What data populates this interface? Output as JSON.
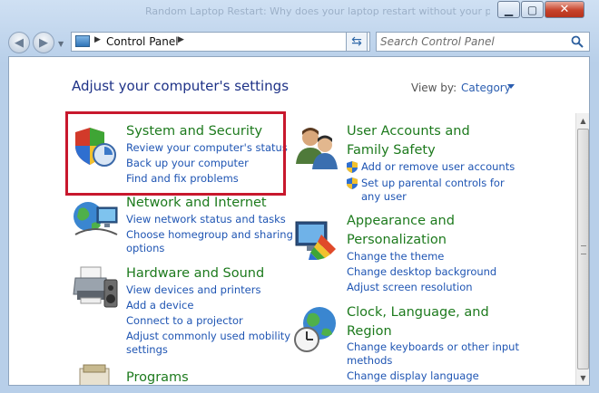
{
  "window": {
    "title_fragment": "Random Laptop Restart: Why does your laptop restart without your permission"
  },
  "nav": {
    "breadcrumb": "Control Panel",
    "search_placeholder": "Search Control Panel"
  },
  "main": {
    "heading": "Adjust your computer's settings",
    "view_by_label": "View by:",
    "view_by_value": "Category"
  },
  "categories": [
    {
      "title": "System and Security",
      "links": [
        "Review your computer's status",
        "Back up your computer",
        "Find and fix problems"
      ]
    },
    {
      "title": "Network and Internet",
      "links": [
        "View network status and tasks",
        "Choose homegroup and sharing",
        "options"
      ]
    },
    {
      "title": "Hardware and Sound",
      "links": [
        "View devices and printers",
        "Add a device",
        "Connect to a projector",
        "Adjust commonly used mobility",
        "settings"
      ]
    },
    {
      "title": "Programs",
      "links": []
    },
    {
      "title_lines": [
        "User Accounts and",
        "Family Safety"
      ],
      "links": [
        "Add or remove user accounts",
        "Set up parental controls for",
        "any user"
      ]
    },
    {
      "title_lines": [
        "Appearance and",
        "Personalization"
      ],
      "links": [
        "Change the theme",
        "Change desktop background",
        "Adjust screen resolution"
      ]
    },
    {
      "title_lines": [
        "Clock, Language, and",
        "Region"
      ],
      "links": [
        "Change keyboards or other input",
        "methods",
        "Change display language"
      ]
    }
  ],
  "colors": {
    "category_title": "#1d7a1d",
    "link": "#1f55b3",
    "heading": "#1e3287",
    "highlight_box": "#c8182d"
  }
}
